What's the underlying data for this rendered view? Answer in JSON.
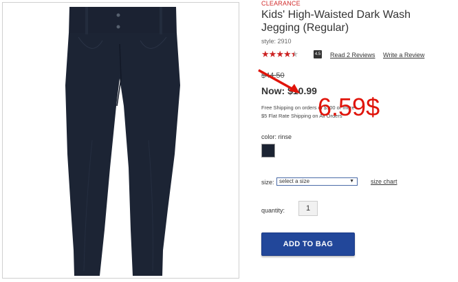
{
  "product": {
    "badge": "CLEARANCE",
    "title": "Kids' High-Waisted Dark Wash Jegging (Regular)",
    "style": "style: 2910",
    "rating_value": 4.5,
    "rating_badge": "4.5",
    "reviews_link": "Read 2 Reviews",
    "write_review_link": "Write a Review",
    "old_price": "$44.50",
    "now_price": "Now: $10.99",
    "shipping_line1": "Free Shipping on orders of $100 or more",
    "shipping_line2": "$5 Flat Rate Shipping on All Orders"
  },
  "annotation": {
    "price_note": "6.59$",
    "color": "#e0140a"
  },
  "options": {
    "color_label": "color: rinse",
    "swatch_color": "#1b2332",
    "size_label": "size:",
    "size_placeholder": "select a size",
    "size_chart_link": "size chart",
    "quantity_label": "quantity:",
    "quantity_value": "1"
  },
  "actions": {
    "add_to_bag": "ADD TO BAG",
    "button_color": "#22479a"
  },
  "icons": {
    "star": "star-icon",
    "dropdown": "chevron-down-icon"
  }
}
